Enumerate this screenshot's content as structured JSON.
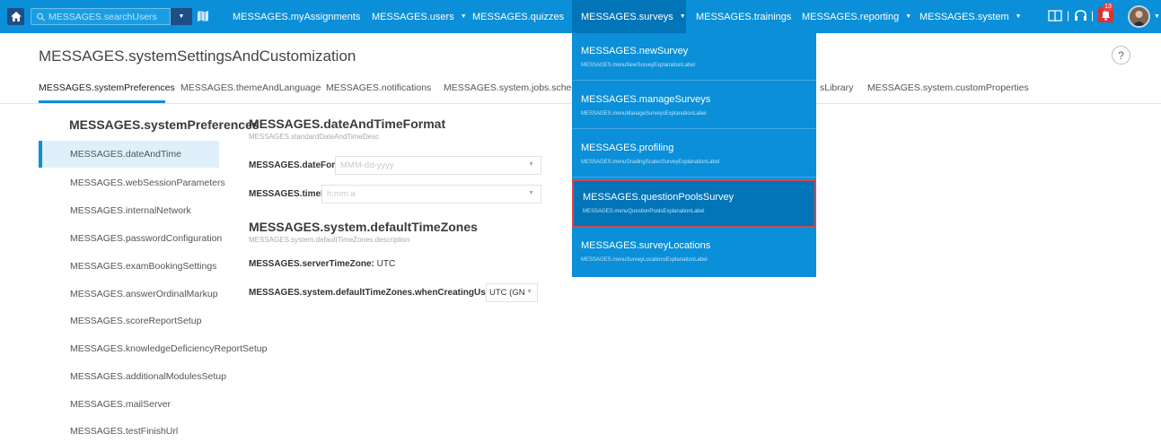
{
  "topbar": {
    "search_placeholder": "MESSAGES.searchUsers",
    "nav": [
      {
        "label": "MESSAGES.myAssignments"
      },
      {
        "label": "MESSAGES.users"
      },
      {
        "label": "MESSAGES.quizzes"
      },
      {
        "label": "MESSAGES.surveys"
      },
      {
        "label": "MESSAGES.trainings"
      },
      {
        "label": "MESSAGES.reporting"
      },
      {
        "label": "MESSAGES.system"
      }
    ],
    "notification_count": "13",
    "colors": {
      "bar": "#0a8fd8",
      "active": "#0274b8",
      "dark": "#1f4d86"
    }
  },
  "header": {
    "title": "MESSAGES.systemSettingsAndCustomization",
    "help": "?"
  },
  "tabs": [
    {
      "label": "MESSAGES.systemPreferences"
    },
    {
      "label": "MESSAGES.themeAndLanguage"
    },
    {
      "label": "MESSAGES.notifications"
    },
    {
      "label": "MESSAGES.system.jobs.schedul"
    },
    {
      "label": "sLibrary"
    },
    {
      "label": "MESSAGES.system.customProperties"
    }
  ],
  "sidebar": {
    "heading": "MESSAGES.systemPreferences",
    "items": [
      {
        "label": "MESSAGES.dateAndTime"
      },
      {
        "label": "MESSAGES.webSessionParameters"
      },
      {
        "label": "MESSAGES.internalNetwork"
      },
      {
        "label": "MESSAGES.passwordConfiguration"
      },
      {
        "label": "MESSAGES.examBookingSettings"
      },
      {
        "label": "MESSAGES.answerOrdinalMarkup"
      },
      {
        "label": "MESSAGES.scoreReportSetup"
      },
      {
        "label": "MESSAGES.knowledgeDeficiencyReportSetup"
      },
      {
        "label": "MESSAGES.additionalModulesSetup"
      },
      {
        "label": "MESSAGES.mailServer"
      },
      {
        "label": "MESSAGES.testFinishUrl"
      }
    ]
  },
  "content": {
    "date_time": {
      "title": "MESSAGES.dateAndTimeFormat",
      "desc": "MESSAGES.standardDateAndTimeDesc",
      "date_label": "MESSAGES.dateFormat:",
      "date_value": "MMM-dd-yyyy",
      "time_label": "MESSAGES.timeFormat:",
      "time_value": "h:mm a"
    },
    "timezones": {
      "title": "MESSAGES.system.defaultTimeZones",
      "desc": "MESSAGES.system.defaultTimeZones.description",
      "server_label": "MESSAGES.serverTimeZone:",
      "server_value": "UTC",
      "creating_label": "MESSAGES.system.defaultTimeZones.whenCreatingUsers:",
      "creating_value": "UTC (GN"
    }
  },
  "surveys_menu": [
    {
      "label": "MESSAGES.newSurvey",
      "sub": "MESSAGES.menuNewSurveyExplanationLabel"
    },
    {
      "label": "MESSAGES.manageSurveys",
      "sub": "MESSAGES.menuManageSurveysExplanationLabel"
    },
    {
      "label": "MESSAGES.profiling",
      "sub": "MESSAGES.menuGradingScalesSurveyExplanationLabel"
    },
    {
      "label": "MESSAGES.questionPoolsSurvey",
      "sub": "MESSAGES.menuQuestionPoolsExplanationLabel"
    },
    {
      "label": "MESSAGES.surveyLocations",
      "sub": "MESSAGES.menuSurveyLocationsExplanationLabel"
    }
  ]
}
